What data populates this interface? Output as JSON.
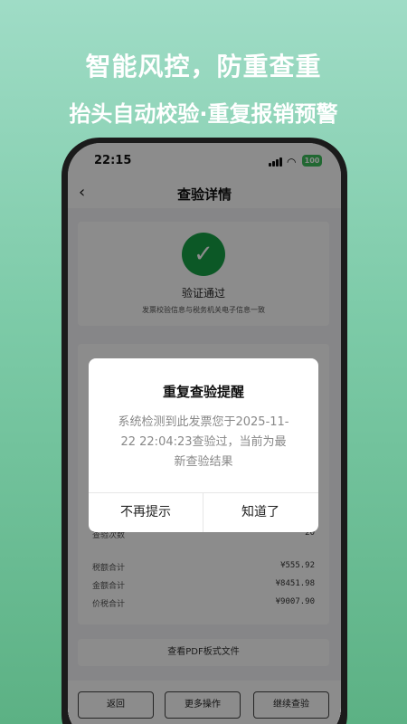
{
  "hero": {
    "title": "智能风控，防重查重",
    "subtitle": "抬头自动校验·重复报销预警"
  },
  "status_bar": {
    "time": "22:15",
    "battery": "100",
    "battery_color": "#3dbd5c"
  },
  "nav": {
    "back_icon": "‹",
    "title": "查验详情"
  },
  "verify": {
    "icon": "✓",
    "title": "验证通过",
    "description": "发票校验信息与税务机关电子信息一致",
    "accent_color": "#16a046"
  },
  "details": {
    "rows": [
      {
        "label": "查验次数",
        "value": "20"
      },
      {
        "label": "税额合计",
        "value": "¥555.92"
      },
      {
        "label": "金额合计",
        "value": "¥8451.98"
      },
      {
        "label": "价税合计",
        "value": "¥9007.90"
      }
    ]
  },
  "pdf_button": "查看PDF板式文件",
  "bottom_bar": {
    "back": "返回",
    "more": "更多操作",
    "continue": "继续查验"
  },
  "dialog": {
    "title": "重复查验提醒",
    "message": "系统检测到此发票您于2025-11-22 22:04:23查验过，当前为最新查验结果",
    "cancel": "不再提示",
    "confirm": "知道了"
  }
}
